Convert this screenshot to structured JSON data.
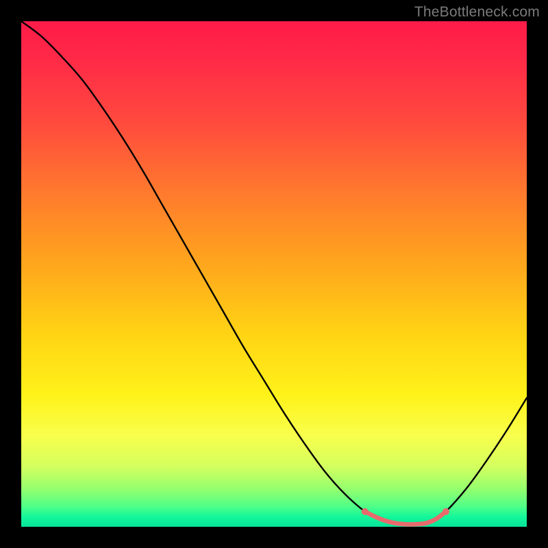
{
  "watermark": "TheBottleneck.com",
  "colors": {
    "background": "#000000",
    "gradient_top": "#ff1b49",
    "gradient_bottom": "#06e39a",
    "curve": "#000000",
    "highlight": "#e86a6d"
  },
  "chart_data": {
    "type": "line",
    "title": "",
    "xlabel": "",
    "ylabel": "",
    "xlim": [
      0,
      100
    ],
    "ylim": [
      0,
      100
    ],
    "x": [
      0,
      4,
      8,
      12,
      16,
      20,
      24,
      28,
      32,
      36,
      40,
      44,
      48,
      52,
      56,
      60,
      64,
      68,
      70,
      72,
      74,
      76,
      78,
      80,
      82,
      84,
      88,
      92,
      96,
      100
    ],
    "values": [
      100,
      97,
      93,
      88.5,
      83,
      77,
      70.5,
      63.5,
      56.5,
      49.5,
      42.5,
      35.5,
      29,
      22.5,
      16.5,
      11,
      6.5,
      3,
      2,
      1.2,
      0.7,
      0.5,
      0.5,
      0.7,
      1.5,
      3,
      7.5,
      13,
      19,
      25.5
    ],
    "highlight_range_x": [
      68,
      84
    ],
    "note": "Values are percent of plot height from bottom; x is percent of plot width. Highlight marks the valley segment rendered in the accent color with endpoint dots."
  }
}
